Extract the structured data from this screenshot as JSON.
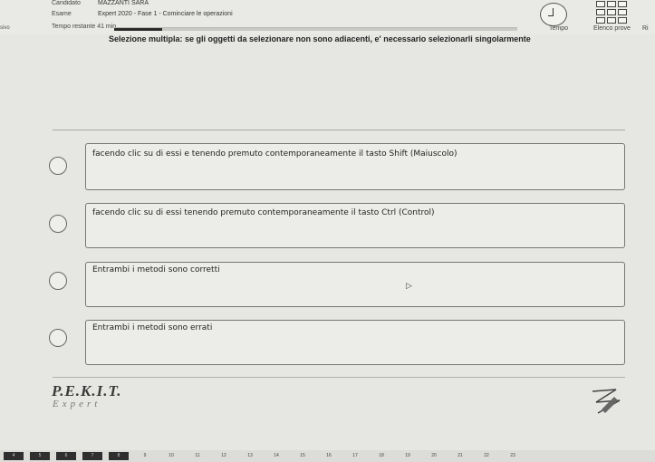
{
  "header": {
    "candidate_label": "Candidato",
    "candidate_name": "MAZZANTI SARA",
    "exam_label": "Esame",
    "exam_value": "Expert 2020 - Fase 1 - Cominciare le operazioni",
    "time_left_label": "Tempo restante 41 min.",
    "prev_label": "sivo",
    "time_label": "Tempo",
    "list_label": "Elenco prove",
    "cut_label": "Ri",
    "progress_fraction": 0.12
  },
  "question": {
    "title": "Selezione multipla: se gli oggetti da selezionare non sono adiacenti, e' necessario selezionarli singolarmente",
    "options": [
      {
        "text": "facendo clic su di essi e tenendo premuto contemporaneamente il tasto Shift (Maiuscolo)"
      },
      {
        "text": "facendo clic su di essi tenendo premuto contemporaneamente il tasto Ctrl (Control)"
      },
      {
        "text": "Entrambi i metodi sono corretti"
      },
      {
        "text": "Entrambi i metodi sono errati"
      }
    ]
  },
  "logo": {
    "main": "P.E.K.I.T.",
    "sub": "Expert"
  },
  "icons": {
    "timer": "timer-icon",
    "grid": "question-grid-icon",
    "pen": "pen-icon",
    "cursor": "mouse-cursor-icon"
  },
  "nav": {
    "items": [
      "4",
      "5",
      "6",
      "7",
      "8",
      "9",
      "10",
      "11",
      "12",
      "13",
      "14",
      "15",
      "16",
      "17",
      "18",
      "19",
      "20",
      "21",
      "22",
      "23"
    ],
    "done_count": 5
  }
}
